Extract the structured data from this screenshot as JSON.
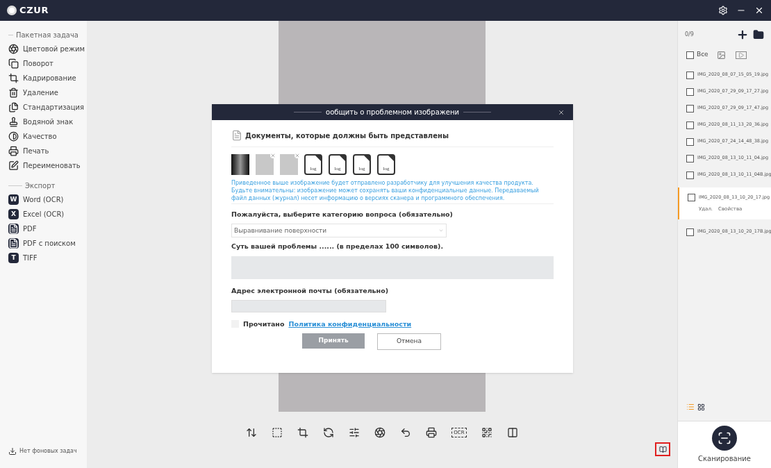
{
  "app": {
    "logo": "CZUR"
  },
  "sidebar": {
    "sections": [
      {
        "title": "Пакетная задача",
        "items": [
          {
            "label": "Цветовой режим"
          },
          {
            "label": "Поворот"
          },
          {
            "label": "Кадрирование"
          },
          {
            "label": "Удаление"
          },
          {
            "label": "Стандартизация"
          },
          {
            "label": "Водяной знак"
          },
          {
            "label": "Качество"
          },
          {
            "label": "Печать"
          },
          {
            "label": "Переименовать"
          }
        ]
      },
      {
        "title": "Экспорт",
        "items": [
          {
            "label": "Word (OCR)",
            "badge": "W"
          },
          {
            "label": "Excel (OCR)",
            "badge": "X"
          },
          {
            "label": "PDF"
          },
          {
            "label": "PDF с поиском"
          },
          {
            "label": "TIFF",
            "badge": "T"
          }
        ]
      }
    ],
    "status": "Нет фоновых задач"
  },
  "toolbar": {
    "tools": [
      {
        "kind": "icon"
      },
      {
        "kind": "icon"
      },
      {
        "kind": "icon"
      },
      {
        "kind": "icon"
      },
      {
        "kind": "icon"
      },
      {
        "kind": "icon"
      },
      {
        "kind": "icon"
      },
      {
        "kind": "icon"
      },
      {
        "kind": "text",
        "label": "OCR"
      },
      {
        "kind": "icon"
      },
      {
        "kind": "icon"
      }
    ]
  },
  "feedback_button": {
    "highlighted": true
  },
  "files": {
    "counter": "0/9",
    "select_all": {
      "label": "Все",
      "checked": false
    },
    "items": [
      {
        "name": "IMG_2020_08_07_15_05_19.jpg",
        "checked": false,
        "selected": false
      },
      {
        "name": "IMG_2020_07_29_09_17_27.jpg",
        "checked": false,
        "selected": false
      },
      {
        "name": "IMG_2020_07_29_09_17_47.jpg",
        "checked": false,
        "selected": false
      },
      {
        "name": "IMG_2020_08_11_13_20_36.jpg",
        "checked": false,
        "selected": false
      },
      {
        "name": "IMG_2020_07_24_14_48_38.jpg",
        "checked": false,
        "selected": false
      },
      {
        "name": "IMG_2020_08_13_10_11_04.jpg",
        "checked": false,
        "selected": false
      },
      {
        "name": "IMG_2020_08_13_10_11_04B.jpg",
        "checked": false,
        "selected": false
      },
      {
        "name": "IMG_2020_08_13_10_20_17.jpg",
        "checked": false,
        "selected": true,
        "actions": [
          "Удал.",
          "Свойства"
        ]
      },
      {
        "name": "IMG_2020_08_13_10_20_17B.jpg",
        "checked": false,
        "selected": false
      }
    ],
    "views": [
      {
        "selected": true
      },
      {
        "selected": false
      }
    ],
    "scan_label": "Сканирование"
  },
  "dialog": {
    "title": "ообщить о проблемном изображени",
    "section_title": "Документы, которые должны быть представлены",
    "attachments": [
      {
        "kind": "dark"
      },
      {
        "kind": "page",
        "removable": true
      },
      {
        "kind": "page",
        "removable": true
      },
      {
        "kind": "log",
        "label": "log"
      },
      {
        "kind": "log",
        "label": "log"
      },
      {
        "kind": "log",
        "label": "log"
      },
      {
        "kind": "log",
        "label": "log"
      }
    ],
    "notice": [
      "Приведенное выше изображение будет отправлено разработчику для улучшения качества продукта.",
      "Будьте внимательны: изображение может сохранять ваши конфиденциальные данные. Передаваемый файл данных (журнал) несет информацию о версиях сканера и программного обеспечения."
    ],
    "category_label": "Пожалуйста, выберите категорию вопроса (обязательно)",
    "category_value": "Выравнивание поверхности",
    "problem_label": "Суть вашей проблемы ...... (в пределах 100 символов).",
    "email_label": "Адрес электронной почты (обязательно)",
    "agree": {
      "checked": false,
      "text": "Прочитано",
      "link": "Политика конфиденциальности"
    },
    "accept": {
      "label": "Принять",
      "disabled": true
    },
    "cancel": {
      "label": "Отмена"
    }
  }
}
